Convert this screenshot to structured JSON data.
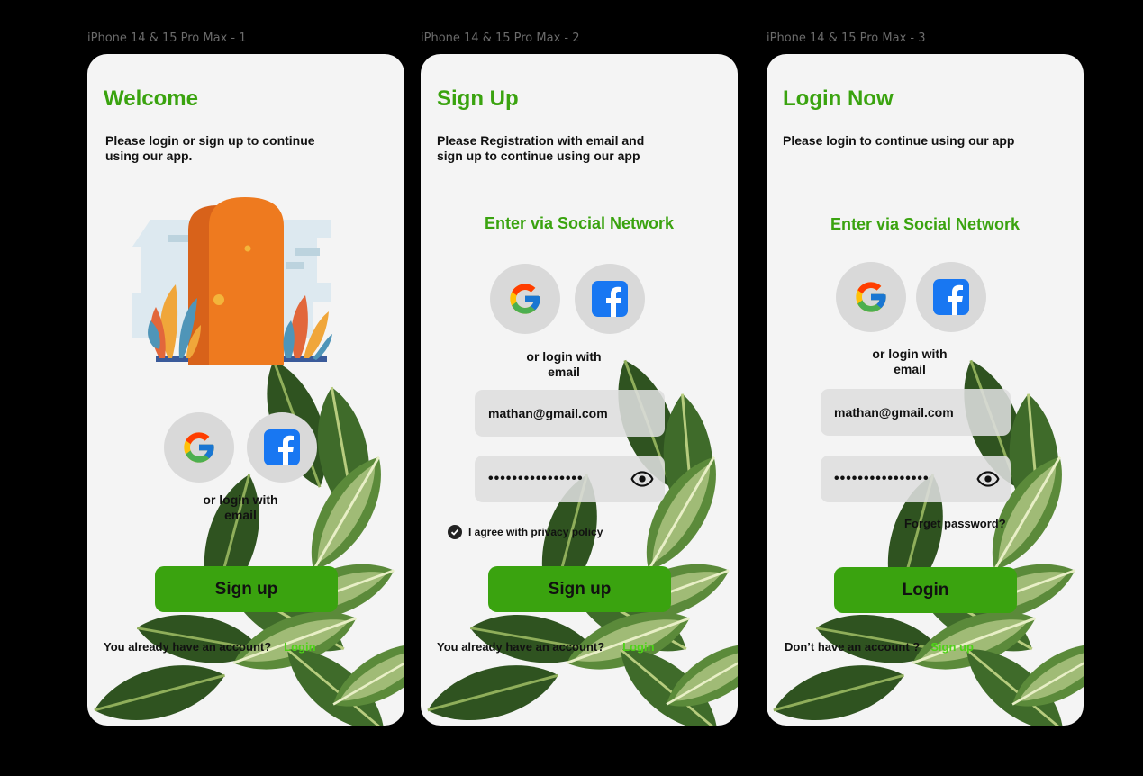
{
  "frames": [
    {
      "label": "iPhone 14 & 15 Pro Max - 1",
      "title": "Welcome",
      "subtitle": "Please login or sign up to continue using our app.",
      "illustration_icon": "door-illustration",
      "social": {
        "google_icon": "google-icon",
        "facebook_icon": "facebook-icon"
      },
      "or_login_text": "or login with email",
      "primary_button": "Sign up",
      "bottom_text": "You already have an account?",
      "bottom_link": "Login"
    },
    {
      "label": "iPhone 14 & 15 Pro Max - 2",
      "title": "Sign Up",
      "subtitle": "Please Registration with email and sign up to continue using our app",
      "social_heading": "Enter via Social Network",
      "social": {
        "google_icon": "google-icon",
        "facebook_icon": "facebook-icon"
      },
      "or_login_text": "or login with email",
      "email_value": "mathan@gmail.com",
      "password_value": "••••••••••••••••",
      "checkbox_label": "I agree with privacy policy",
      "checkbox_checked": true,
      "primary_button": "Sign up",
      "bottom_text": "You already have an account?",
      "bottom_link": "Login"
    },
    {
      "label": "iPhone 14 & 15 Pro Max - 3",
      "title": "Login Now",
      "subtitle": "Please login to continue using our app",
      "social_heading": "Enter via Social Network",
      "social": {
        "google_icon": "google-icon",
        "facebook_icon": "facebook-icon"
      },
      "or_login_text": "or login with email",
      "email_value": "mathan@gmail.com",
      "password_value": "••••••••••••••••",
      "forget_password": "Forget password?",
      "primary_button": "Login",
      "bottom_text": "Don’t have an account ?",
      "bottom_link": "Sign up"
    }
  ],
  "colors": {
    "canvas": "#000000",
    "screen": "#f4f4f4",
    "accent_green": "#3aa30f",
    "link_green": "#4ed318",
    "social_bg": "#d9d9d9",
    "door_orange": "#ee7a1f",
    "facebook_blue": "#1877f2"
  }
}
